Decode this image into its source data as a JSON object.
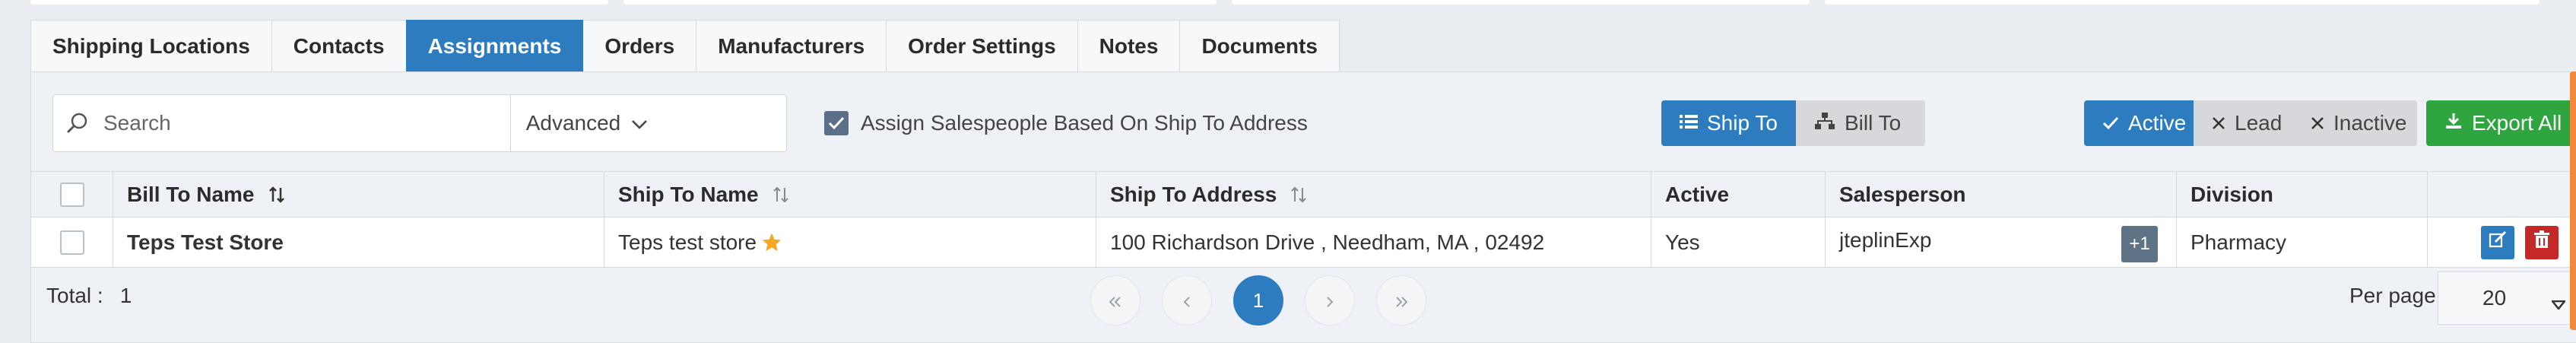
{
  "tabs": [
    {
      "label": "Shipping Locations",
      "active": false
    },
    {
      "label": "Contacts",
      "active": false
    },
    {
      "label": "Assignments",
      "active": true
    },
    {
      "label": "Orders",
      "active": false
    },
    {
      "label": "Manufacturers",
      "active": false
    },
    {
      "label": "Order Settings",
      "active": false
    },
    {
      "label": "Notes",
      "active": false
    },
    {
      "label": "Documents",
      "active": false
    }
  ],
  "toolbar": {
    "search_placeholder": "Search",
    "search_value": "",
    "advanced_label": "Advanced",
    "assign_checkbox_label": "Assign Salespeople Based On Ship To Address",
    "assign_checked": true,
    "ship_to_label": "Ship To",
    "bill_to_label": "Bill To",
    "active_label": "Active",
    "lead_label": "Lead",
    "inactive_label": "Inactive",
    "export_label": "Export All"
  },
  "table": {
    "headers": {
      "bill_to_name": "Bill To Name",
      "ship_to_name": "Ship To Name",
      "ship_to_address": "Ship To Address",
      "active": "Active",
      "salesperson": "Salesperson",
      "division": "Division"
    },
    "rows": [
      {
        "bill_to_name": "Teps Test Store",
        "ship_to_name": "Teps test store",
        "ship_to_address": "100 Richardson Drive , Needham, MA , 02492",
        "active": "Yes",
        "salesperson": "jteplinExp",
        "salesperson_extra": "+1",
        "division": "Pharmacy"
      }
    ]
  },
  "footer": {
    "total_label": "Total :",
    "total_value": "1",
    "current_page": "1",
    "per_page_label": "Per page:",
    "per_page_value": "20"
  },
  "colors": {
    "primary": "#2e7cc0",
    "success": "#2fa53f",
    "danger": "#c62828",
    "star": "#f5a623",
    "accent": "#f0883e"
  }
}
